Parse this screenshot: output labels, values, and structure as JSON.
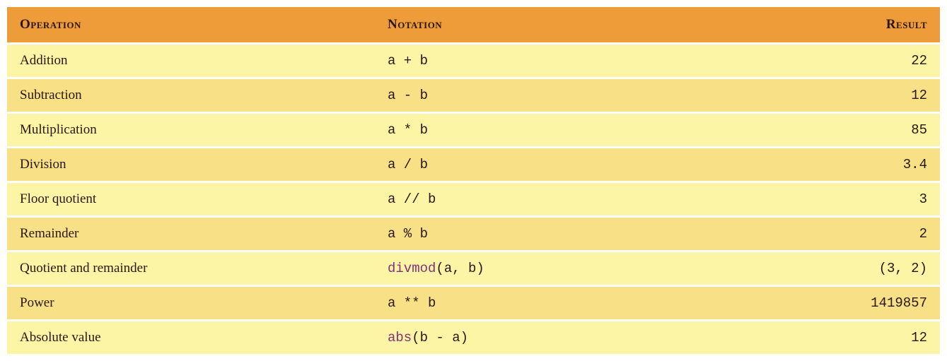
{
  "headers": {
    "operation": "Operation",
    "notation": "Notation",
    "result": "Result"
  },
  "rows": [
    {
      "operation": "Addition",
      "notation_plain": "a + b",
      "notation_html": "a + b",
      "result": "22"
    },
    {
      "operation": "Subtraction",
      "notation_plain": "a - b",
      "notation_html": "a - b",
      "result": "12"
    },
    {
      "operation": "Multiplication",
      "notation_plain": "a * b",
      "notation_html": "a * b",
      "result": "85"
    },
    {
      "operation": "Division",
      "notation_plain": "a / b",
      "notation_html": "a / b",
      "result": "3.4"
    },
    {
      "operation": "Floor quotient",
      "notation_plain": "a // b",
      "notation_html": "a // b",
      "result": "3"
    },
    {
      "operation": "Remainder",
      "notation_plain": "a % b",
      "notation_html": "a % b",
      "result": "2"
    },
    {
      "operation": "Quotient and remainder",
      "notation_plain": "divmod(a, b)",
      "notation_html": "<span class=\"fn\">divmod</span>(a, b)",
      "result": "(3, 2)"
    },
    {
      "operation": "Power",
      "notation_plain": "a ** b",
      "notation_html": "a ** b",
      "result": "1419857"
    },
    {
      "operation": "Absolute value",
      "notation_plain": "abs(b - a)",
      "notation_html": "<span class=\"fn\">abs</span>(b - a)",
      "result": "12"
    }
  ]
}
